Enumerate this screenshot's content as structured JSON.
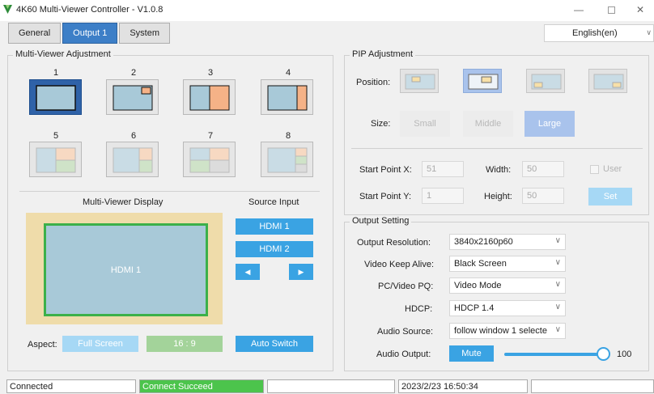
{
  "window": {
    "title": "4K60 Multi-Viewer Controller - V1.0.8"
  },
  "tabs": [
    "General",
    "Output 1",
    "System"
  ],
  "language": "English(en)",
  "multiviewer": {
    "title": "Multi-Viewer Adjustment",
    "layouts": [
      "1",
      "2",
      "3",
      "4",
      "5",
      "6",
      "7",
      "8"
    ],
    "selected": "1"
  },
  "display": {
    "title": "Multi-Viewer Display",
    "window_label": "HDMI 1"
  },
  "source": {
    "title": "Source Input",
    "inputs": [
      "HDMI 1",
      "HDMI 2"
    ]
  },
  "aspect": {
    "label": "Aspect:",
    "full_screen": "Full Screen",
    "ratio": "16 : 9",
    "auto_switch": "Auto Switch"
  },
  "pip": {
    "title": "PIP Adjustment",
    "position_label": "Position:",
    "size_label": "Size:",
    "sizes": [
      "Small",
      "Middle",
      "Large"
    ],
    "selected_size": "Large",
    "start_x_label": "Start Point X:",
    "start_x": "51",
    "start_y_label": "Start Point Y:",
    "start_y": "1",
    "width_label": "Width:",
    "width": "50",
    "height_label": "Height:",
    "height": "50",
    "user_label": "User",
    "set_label": "Set"
  },
  "output": {
    "title": "Output Setting",
    "resolution_label": "Output Resolution:",
    "resolution": "3840x2160p60",
    "keepalive_label": "Video Keep Alive:",
    "keepalive": "Black Screen",
    "pq_label": "PC/Video PQ:",
    "pq": "Video Mode",
    "hdcp_label": "HDCP:",
    "hdcp": "HDCP 1.4",
    "audio_source_label": "Audio Source:",
    "audio_source": "follow window 1 selecte",
    "audio_output_label": "Audio Output:",
    "mute_label": "Mute",
    "volume": "100"
  },
  "status": {
    "connection": "Connected",
    "message": "Connect Succeed",
    "datetime": "2023/2/23 16:50:34"
  },
  "colors": {
    "accent": "#3aa3e3",
    "selected_blue": "#2f62a8",
    "orange": "#f5b287",
    "green_border": "#3cb04a",
    "status_green": "#4cc44c"
  }
}
